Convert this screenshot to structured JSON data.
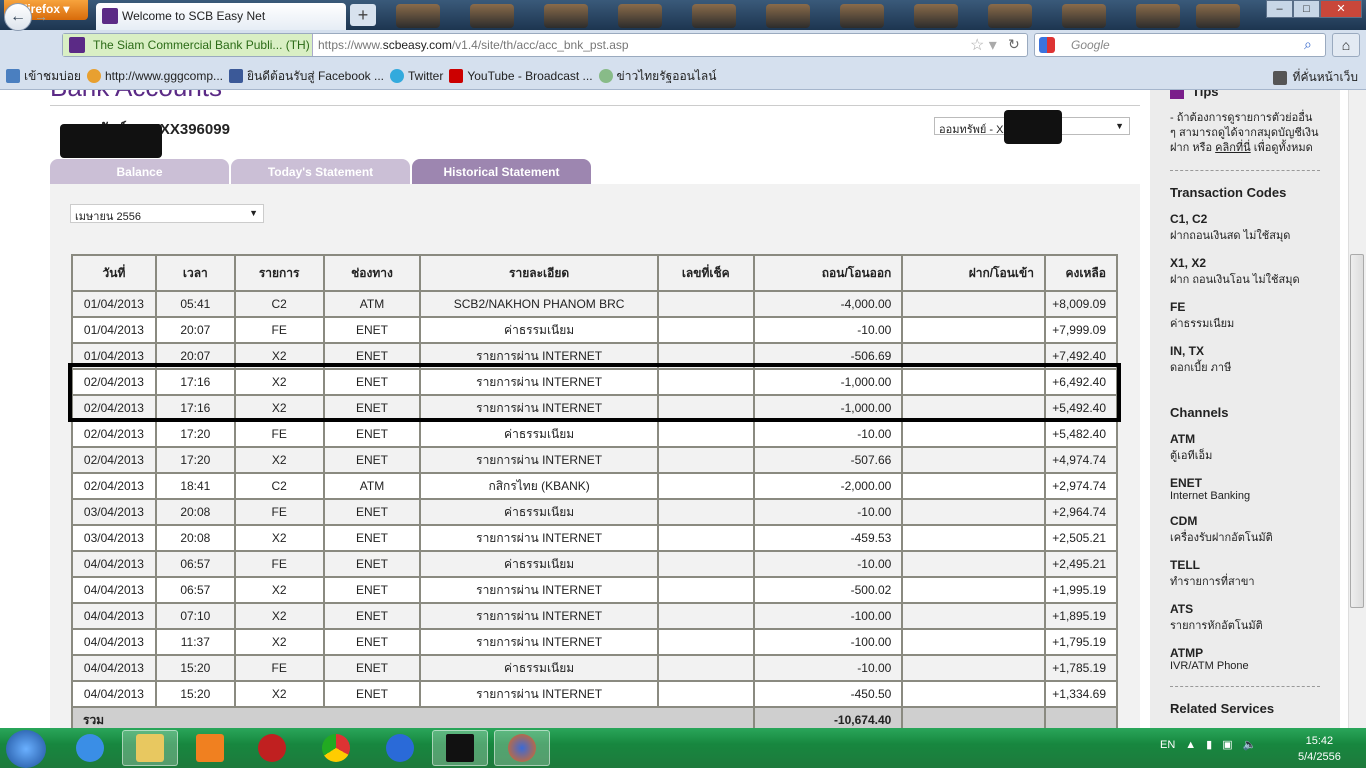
{
  "browser": {
    "menu_label": "Firefox ▾",
    "tab_title": "Welcome to SCB Easy Net",
    "new_tab": "+",
    "identity": "The Siam Commercial Bank Publi...  (TH)",
    "url_prefix": "https://www.",
    "url_domain": "scbeasy.com",
    "url_path": "/v1.4/site/th/acc/acc_bnk_pst.asp",
    "search_placeholder": "Google",
    "bookmarks": [
      "เข้าชมบ่อย",
      "http://www.gggcomp...",
      "ยินดีต้อนรับสู่ Facebook ...",
      "Twitter",
      "YouTube - Broadcast ...",
      "ข่าวไทยรัฐออนไลน์"
    ],
    "bookmarks_right": "ที่คั่นหน้าเว็บ"
  },
  "page": {
    "title": "Bank Accounts",
    "account": "ออมทรัพย์ - XXXX396099",
    "account_select": "ออมทรัพย์ - XX",
    "tabs": [
      "Balance",
      "Today's Statement",
      "Historical Statement"
    ],
    "active_tab": 2,
    "month_select": "เมษายน 2556",
    "columns": [
      "วันที่",
      "เวลา",
      "รายการ",
      "ช่องทาง",
      "รายละเอียด",
      "เลขที่เช็ค",
      "ถอน/โอนออก",
      "ฝาก/โอนเข้า",
      "คงเหลือ"
    ],
    "rows": [
      [
        "01/04/2013",
        "05:41",
        "C2",
        "ATM",
        "SCB2/NAKHON PHANOM BRC",
        "",
        "-4,000.00",
        "",
        "+8,009.09"
      ],
      [
        "01/04/2013",
        "20:07",
        "FE",
        "ENET",
        "ค่าธรรมเนียม",
        "",
        "-10.00",
        "",
        "+7,999.09"
      ],
      [
        "01/04/2013",
        "20:07",
        "X2",
        "ENET",
        "รายการผ่าน INTERNET",
        "",
        "-506.69",
        "",
        "+7,492.40"
      ],
      [
        "02/04/2013",
        "17:16",
        "X2",
        "ENET",
        "รายการผ่าน INTERNET",
        "",
        "-1,000.00",
        "",
        "+6,492.40"
      ],
      [
        "02/04/2013",
        "17:16",
        "X2",
        "ENET",
        "รายการผ่าน INTERNET",
        "",
        "-1,000.00",
        "",
        "+5,492.40"
      ],
      [
        "02/04/2013",
        "17:20",
        "FE",
        "ENET",
        "ค่าธรรมเนียม",
        "",
        "-10.00",
        "",
        "+5,482.40"
      ],
      [
        "02/04/2013",
        "17:20",
        "X2",
        "ENET",
        "รายการผ่าน INTERNET",
        "",
        "-507.66",
        "",
        "+4,974.74"
      ],
      [
        "02/04/2013",
        "18:41",
        "C2",
        "ATM",
        "กสิกรไทย (KBANK)",
        "",
        "-2,000.00",
        "",
        "+2,974.74"
      ],
      [
        "03/04/2013",
        "20:08",
        "FE",
        "ENET",
        "ค่าธรรมเนียม",
        "",
        "-10.00",
        "",
        "+2,964.74"
      ],
      [
        "03/04/2013",
        "20:08",
        "X2",
        "ENET",
        "รายการผ่าน INTERNET",
        "",
        "-459.53",
        "",
        "+2,505.21"
      ],
      [
        "04/04/2013",
        "06:57",
        "FE",
        "ENET",
        "ค่าธรรมเนียม",
        "",
        "-10.00",
        "",
        "+2,495.21"
      ],
      [
        "04/04/2013",
        "06:57",
        "X2",
        "ENET",
        "รายการผ่าน INTERNET",
        "",
        "-500.02",
        "",
        "+1,995.19"
      ],
      [
        "04/04/2013",
        "07:10",
        "X2",
        "ENET",
        "รายการผ่าน INTERNET",
        "",
        "-100.00",
        "",
        "+1,895.19"
      ],
      [
        "04/04/2013",
        "11:37",
        "X2",
        "ENET",
        "รายการผ่าน INTERNET",
        "",
        "-100.00",
        "",
        "+1,795.19"
      ],
      [
        "04/04/2013",
        "15:20",
        "FE",
        "ENET",
        "ค่าธรรมเนียม",
        "",
        "-10.00",
        "",
        "+1,785.19"
      ],
      [
        "04/04/2013",
        "15:20",
        "X2",
        "ENET",
        "รายการผ่าน INTERNET",
        "",
        "-450.50",
        "",
        "+1,334.69"
      ]
    ],
    "total_label": "รวม",
    "total_withdraw": "-10,674.40"
  },
  "sidebar": {
    "tips_title": "Tips",
    "tips_text": "- ถ้าต้องการดูรายการตัวย่ออื่น ๆ สามารถดูได้จากสมุดบัญชีเงินฝาก หรือ",
    "tips_link": "คลิกที่นี่",
    "tips_text2": "เพื่อดูทั้งหมด",
    "codes_title": "Transaction Codes",
    "codes": [
      {
        "code": "C1, C2",
        "desc": "ฝากถอนเงินสด ไม่ใช้สมุด"
      },
      {
        "code": "X1, X2",
        "desc": "ฝาก ถอนเงินโอน ไม่ใช้สมุด"
      },
      {
        "code": "FE",
        "desc": "ค่าธรรมเนียม"
      },
      {
        "code": "IN, TX",
        "desc": "ดอกเบี้ย ภาษี"
      }
    ],
    "channels_title": "Channels",
    "channels": [
      {
        "code": "ATM",
        "desc": "ตู้เอทีเอ็ม"
      },
      {
        "code": "ENET",
        "desc": "Internet Banking"
      },
      {
        "code": "CDM",
        "desc": "เครื่องรับฝากอัตโนมัติ"
      },
      {
        "code": "TELL",
        "desc": "ทำรายการที่สาขา"
      },
      {
        "code": "ATS",
        "desc": "รายการหักอัตโนมัติ"
      },
      {
        "code": "ATMP",
        "desc": "IVR/ATM Phone"
      }
    ],
    "related_title": "Related Services"
  },
  "taskbar": {
    "lang": "EN",
    "time": "15:42",
    "date": "5/4/2556"
  },
  "colors": {
    "brand": "#5b2a86",
    "tab_active": "#9d86b0",
    "tab_inactive": "#cbbfd6"
  }
}
